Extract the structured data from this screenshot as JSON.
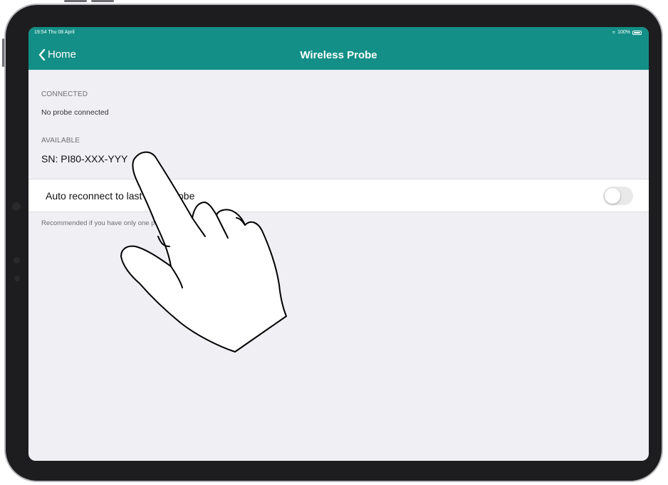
{
  "status_bar": {
    "time": "19:54 Thu 08 April",
    "battery": "100%"
  },
  "nav": {
    "back_label": "Home",
    "title": "Wireless Probe"
  },
  "connected": {
    "header": "CONNECTED",
    "text": "No probe connected"
  },
  "available": {
    "header": "AVAILABLE",
    "probe_sn": "SN: PI80-XXX-YYY"
  },
  "auto_reconnect": {
    "label": "Auto reconnect to last used probe",
    "toggle_on": false,
    "footnote": "Recommended if you have only one probe"
  },
  "colors": {
    "accent": "#138f87",
    "background": "#efeff4"
  }
}
